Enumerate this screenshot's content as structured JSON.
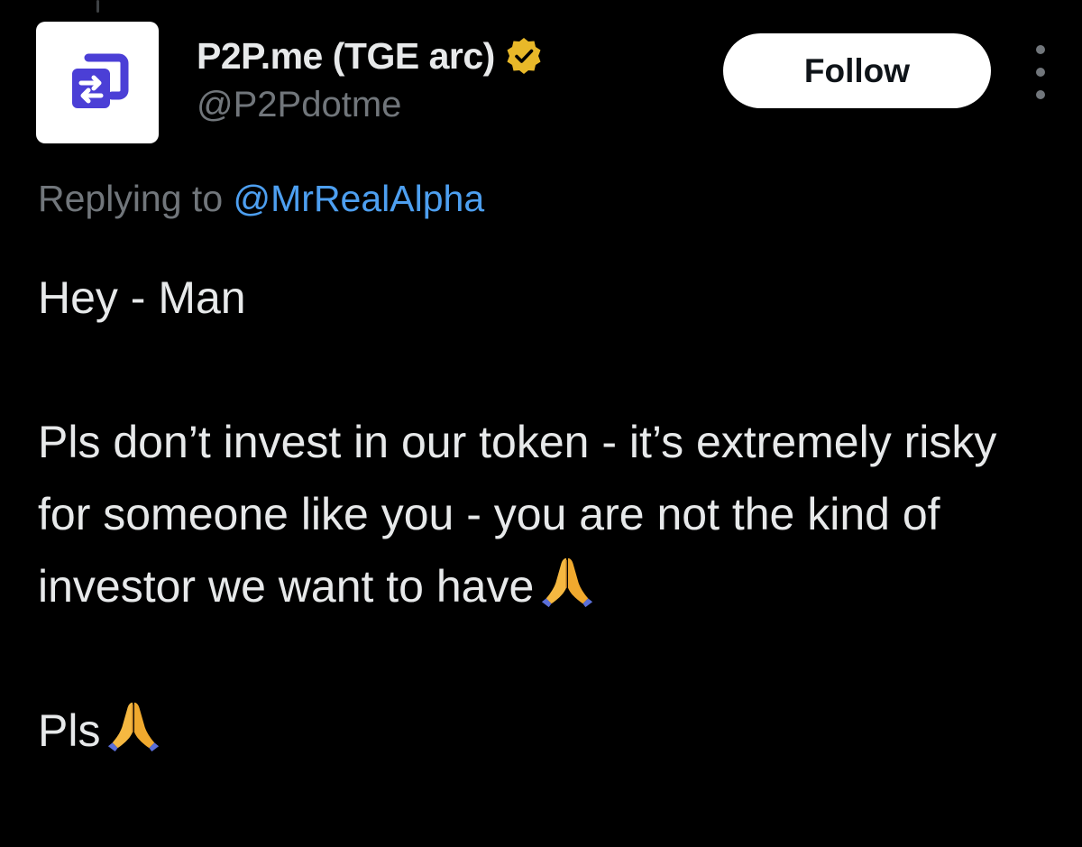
{
  "tweet": {
    "author": {
      "display_name": "P2P.me (TGE arc)",
      "handle": "@P2Pdotme",
      "verified_badge": "gold-check-badge-icon",
      "avatar_icon": "p2p-logo-icon"
    },
    "follow_label": "Follow",
    "more_icon": "more-vertical-icon",
    "reply": {
      "prefix": "Replying to ",
      "mention": "@MrRealAlpha"
    },
    "body": {
      "line1": "Hey - Man",
      "paragraph2": "Pls don’t invest in our token - it’s extremely risky for someone like you - you are not the kind of investor we want to have",
      "paragraph3": "Pls",
      "emoji": "folded-hands-icon"
    }
  },
  "colors": {
    "background": "#000000",
    "text_primary": "#e7e9ea",
    "text_secondary": "#71767b",
    "link": "#4d9ff0",
    "verified_gold": "#e8b829",
    "logo_blue": "#4b3fd6"
  }
}
